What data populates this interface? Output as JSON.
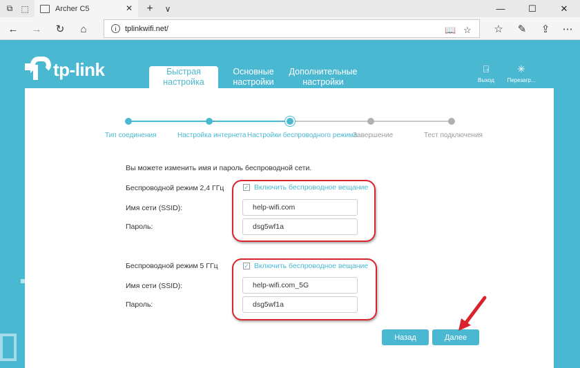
{
  "browser": {
    "tab_title": "Archer C5",
    "url": "tplinkwifi.net/",
    "new_tab_symbol": "+",
    "tab_menu_symbol": "∨"
  },
  "header": {
    "logo_text": "tp-link",
    "tabs": [
      {
        "label": "Быстрая настройка",
        "active": true
      },
      {
        "label": "Основные настройки",
        "active": false
      },
      {
        "label": "Дополнительные настройки",
        "active": false
      }
    ],
    "logout_label": "Выход",
    "reboot_label": "Перезагр..."
  },
  "stepper": {
    "steps": [
      {
        "label": "Тип соединения",
        "state": "done"
      },
      {
        "label": "Настройка интернета",
        "state": "done"
      },
      {
        "label": "Настройки беспроводного режима",
        "state": "current"
      },
      {
        "label": "Завершение",
        "state": "pending"
      },
      {
        "label": "Тест подключения",
        "state": "pending"
      }
    ]
  },
  "form": {
    "intro": "Вы можете изменить имя и пароль беспроводной сети.",
    "band24": {
      "label": "Беспроводной режим 2,4 ГГц",
      "enable_label": "Включить беспроводное вещание",
      "enabled": true,
      "ssid_label": "Имя сети (SSID):",
      "ssid_value": "help-wifi.com",
      "password_label": "Пароль:",
      "password_value": "dsg5wf1a"
    },
    "band5": {
      "label": "Беспроводной режим 5 ГГц",
      "enable_label": "Включить беспроводное вещание",
      "enabled": true,
      "ssid_label": "Имя сети (SSID):",
      "ssid_value": "help-wifi.com_5G",
      "password_label": "Пароль:",
      "password_value": "dsg5wf1a"
    }
  },
  "buttons": {
    "back": "Назад",
    "next": "Далее"
  },
  "colors": {
    "accent": "#4ab8d1",
    "highlight": "#d9232d",
    "pending": "#9a9a9a"
  }
}
